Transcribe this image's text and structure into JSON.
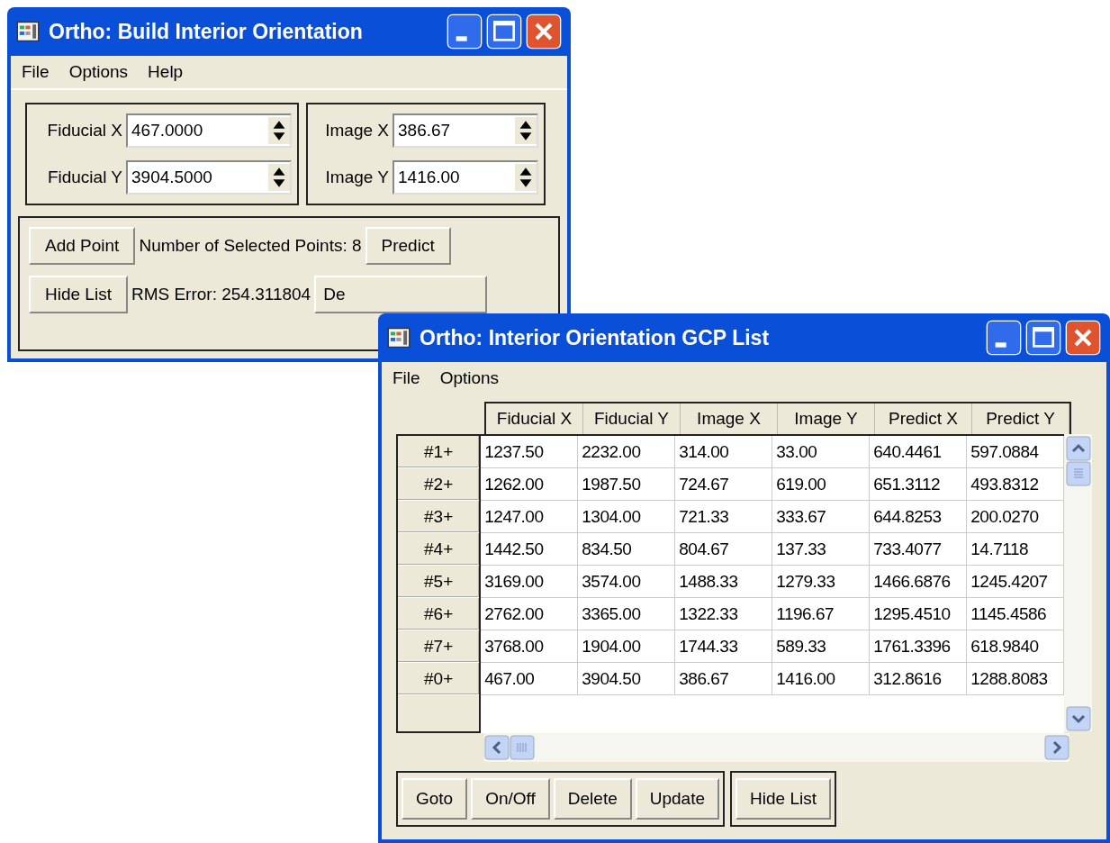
{
  "build_window": {
    "title": "Ortho: Build Interior Orientation",
    "menu": [
      "File",
      "Options",
      "Help"
    ],
    "field_groups": [
      [
        {
          "label": "Fiducial X",
          "value": "467.0000"
        },
        {
          "label": "Fiducial Y",
          "value": "3904.5000"
        }
      ],
      [
        {
          "label": "Image X",
          "value": "386.67"
        },
        {
          "label": "Image Y",
          "value": "1416.00"
        }
      ]
    ],
    "action_rows": [
      [
        {
          "kind": "button",
          "text": "Add Point"
        },
        {
          "kind": "label",
          "text": "Number of Selected Points: 8"
        },
        {
          "kind": "button",
          "text": "Predict"
        }
      ],
      [
        {
          "kind": "button",
          "text": "Hide List"
        },
        {
          "kind": "label",
          "text": "RMS Error: 254.311804"
        },
        {
          "kind": "wide-button",
          "text": "De"
        }
      ]
    ]
  },
  "gcp_list_window": {
    "title": "Ortho: Interior Orientation GCP List",
    "menu": [
      "File",
      "Options"
    ],
    "table": {
      "columns": [
        "Fiducial X",
        "Fiducial Y",
        "Image X",
        "Image Y",
        "Predict X",
        "Predict Y"
      ],
      "rows": [
        {
          "label": "#1+",
          "cells": [
            "1237.50",
            "2232.00",
            "314.00",
            "33.00",
            "640.4461",
            "597.0884"
          ]
        },
        {
          "label": "#2+",
          "cells": [
            "1262.00",
            "1987.50",
            "724.67",
            "619.00",
            "651.3112",
            "493.8312"
          ]
        },
        {
          "label": "#3+",
          "cells": [
            "1247.00",
            "1304.00",
            "721.33",
            "333.67",
            "644.8253",
            "200.0270"
          ]
        },
        {
          "label": "#4+",
          "cells": [
            "1442.50",
            "834.50",
            "804.67",
            "137.33",
            "733.4077",
            "14.7118"
          ]
        },
        {
          "label": "#5+",
          "cells": [
            "3169.00",
            "3574.00",
            "1488.33",
            "1279.33",
            "1466.6876",
            "1245.4207"
          ]
        },
        {
          "label": "#6+",
          "cells": [
            "2762.00",
            "3365.00",
            "1322.33",
            "1196.67",
            "1295.4510",
            "1145.4586"
          ]
        },
        {
          "label": "#7+",
          "cells": [
            "3768.00",
            "1904.00",
            "1744.33",
            "589.33",
            "1761.3396",
            "618.9840"
          ]
        },
        {
          "label": "#0+",
          "cells": [
            "467.00",
            "3904.50",
            "386.67",
            "1416.00",
            "312.8616",
            "1288.8083"
          ]
        }
      ]
    },
    "button_groups": [
      [
        "Goto",
        "On/Off",
        "Delete",
        "Update"
      ],
      [
        "Hide List"
      ]
    ]
  }
}
